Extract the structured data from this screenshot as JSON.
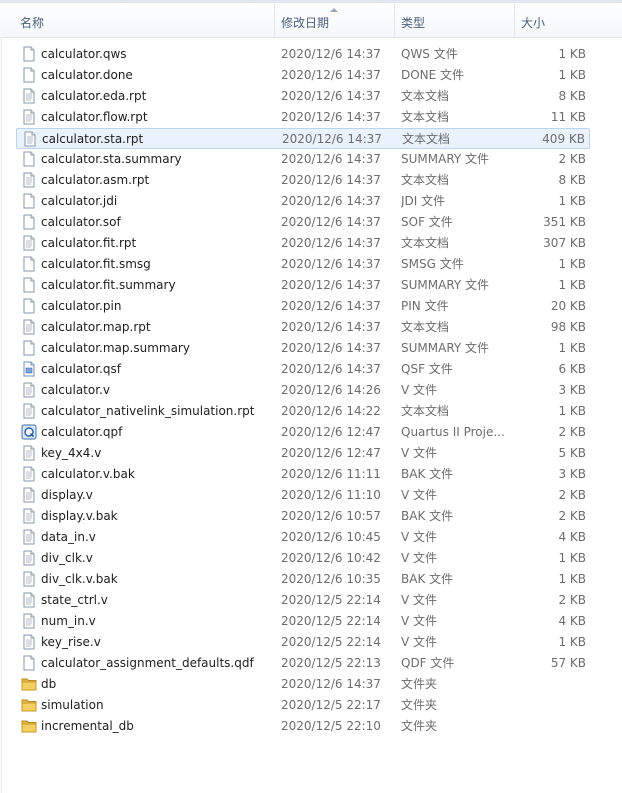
{
  "columns": {
    "name": "名称",
    "date": "修改日期",
    "type": "类型",
    "size": "大小"
  },
  "files": [
    {
      "name": "calculator.qws",
      "date": "2020/12/6 14:37",
      "type": "QWS 文件",
      "size": "1 KB",
      "icon": "document-icon"
    },
    {
      "name": "calculator.done",
      "date": "2020/12/6 14:37",
      "type": "DONE 文件",
      "size": "1 KB",
      "icon": "document-icon"
    },
    {
      "name": "calculator.eda.rpt",
      "date": "2020/12/6 14:37",
      "type": "文本文档",
      "size": "8 KB",
      "icon": "text-document-icon"
    },
    {
      "name": "calculator.flow.rpt",
      "date": "2020/12/6 14:37",
      "type": "文本文档",
      "size": "11 KB",
      "icon": "text-document-icon"
    },
    {
      "name": "calculator.sta.rpt",
      "date": "2020/12/6 14:37",
      "type": "文本文档",
      "size": "409 KB",
      "icon": "text-document-icon",
      "selected": true
    },
    {
      "name": "calculator.sta.summary",
      "date": "2020/12/6 14:37",
      "type": "SUMMARY 文件",
      "size": "2 KB",
      "icon": "document-icon"
    },
    {
      "name": "calculator.asm.rpt",
      "date": "2020/12/6 14:37",
      "type": "文本文档",
      "size": "8 KB",
      "icon": "text-document-icon"
    },
    {
      "name": "calculator.jdi",
      "date": "2020/12/6 14:37",
      "type": "JDI 文件",
      "size": "1 KB",
      "icon": "document-icon"
    },
    {
      "name": "calculator.sof",
      "date": "2020/12/6 14:37",
      "type": "SOF 文件",
      "size": "351 KB",
      "icon": "document-icon"
    },
    {
      "name": "calculator.fit.rpt",
      "date": "2020/12/6 14:37",
      "type": "文本文档",
      "size": "307 KB",
      "icon": "text-document-icon"
    },
    {
      "name": "calculator.fit.smsg",
      "date": "2020/12/6 14:37",
      "type": "SMSG 文件",
      "size": "1 KB",
      "icon": "document-icon"
    },
    {
      "name": "calculator.fit.summary",
      "date": "2020/12/6 14:37",
      "type": "SUMMARY 文件",
      "size": "1 KB",
      "icon": "document-icon"
    },
    {
      "name": "calculator.pin",
      "date": "2020/12/6 14:37",
      "type": "PIN 文件",
      "size": "20 KB",
      "icon": "document-icon"
    },
    {
      "name": "calculator.map.rpt",
      "date": "2020/12/6 14:37",
      "type": "文本文档",
      "size": "98 KB",
      "icon": "text-document-icon"
    },
    {
      "name": "calculator.map.summary",
      "date": "2020/12/6 14:37",
      "type": "SUMMARY 文件",
      "size": "1 KB",
      "icon": "document-icon"
    },
    {
      "name": "calculator.qsf",
      "date": "2020/12/6 14:37",
      "type": "QSF 文件",
      "size": "6 KB",
      "icon": "qsf-file-icon"
    },
    {
      "name": "calculator.v",
      "date": "2020/12/6 14:26",
      "type": "V 文件",
      "size": "3 KB",
      "icon": "text-document-icon"
    },
    {
      "name": "calculator_nativelink_simulation.rpt",
      "date": "2020/12/6 14:22",
      "type": "文本文档",
      "size": "1 KB",
      "icon": "text-document-icon"
    },
    {
      "name": "calculator.qpf",
      "date": "2020/12/6 12:47",
      "type": "Quartus II Proje...",
      "size": "2 KB",
      "icon": "quartus-project-icon"
    },
    {
      "name": "key_4x4.v",
      "date": "2020/12/6 12:47",
      "type": "V 文件",
      "size": "5 KB",
      "icon": "text-document-icon"
    },
    {
      "name": "calculator.v.bak",
      "date": "2020/12/6 11:11",
      "type": "BAK 文件",
      "size": "3 KB",
      "icon": "text-document-icon"
    },
    {
      "name": "display.v",
      "date": "2020/12/6 11:10",
      "type": "V 文件",
      "size": "2 KB",
      "icon": "text-document-icon"
    },
    {
      "name": "display.v.bak",
      "date": "2020/12/6 10:57",
      "type": "BAK 文件",
      "size": "2 KB",
      "icon": "text-document-icon"
    },
    {
      "name": "data_in.v",
      "date": "2020/12/6 10:45",
      "type": "V 文件",
      "size": "4 KB",
      "icon": "text-document-icon"
    },
    {
      "name": "div_clk.v",
      "date": "2020/12/6 10:42",
      "type": "V 文件",
      "size": "1 KB",
      "icon": "text-document-icon"
    },
    {
      "name": "div_clk.v.bak",
      "date": "2020/12/6 10:35",
      "type": "BAK 文件",
      "size": "1 KB",
      "icon": "text-document-icon"
    },
    {
      "name": "state_ctrl.v",
      "date": "2020/12/5 22:14",
      "type": "V 文件",
      "size": "2 KB",
      "icon": "text-document-icon"
    },
    {
      "name": "num_in.v",
      "date": "2020/12/5 22:14",
      "type": "V 文件",
      "size": "4 KB",
      "icon": "text-document-icon"
    },
    {
      "name": "key_rise.v",
      "date": "2020/12/5 22:14",
      "type": "V 文件",
      "size": "1 KB",
      "icon": "text-document-icon"
    },
    {
      "name": "calculator_assignment_defaults.qdf",
      "date": "2020/12/5 22:13",
      "type": "QDF 文件",
      "size": "57 KB",
      "icon": "document-icon"
    },
    {
      "name": "db",
      "date": "2020/12/6 14:37",
      "type": "文件夹",
      "size": "",
      "icon": "folder-icon"
    },
    {
      "name": "simulation",
      "date": "2020/12/5 22:17",
      "type": "文件夹",
      "size": "",
      "icon": "folder-icon"
    },
    {
      "name": "incremental_db",
      "date": "2020/12/5 22:10",
      "type": "文件夹",
      "size": "",
      "icon": "folder-icon"
    }
  ]
}
